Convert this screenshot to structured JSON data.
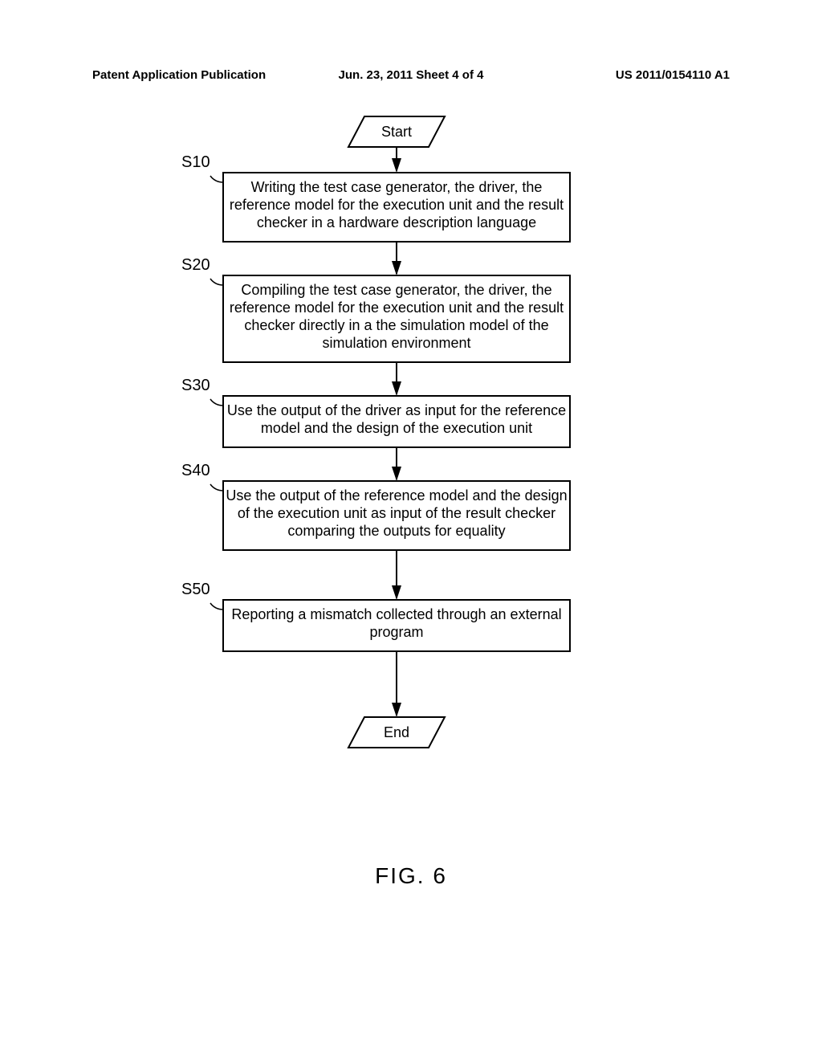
{
  "header": {
    "left": "Patent Application Publication",
    "center": "Jun. 23, 2011  Sheet 4 of 4",
    "right": "US 2011/0154110 A1"
  },
  "flow": {
    "start": "Start",
    "end": "End",
    "steps": [
      {
        "id": "S10",
        "text": [
          "Writing the test case generator, the driver, the",
          "reference model for the execution unit and the result",
          "checker in a hardware description language"
        ]
      },
      {
        "id": "S20",
        "text": [
          "Compiling the test case generator, the driver, the",
          "reference model for the execution unit and the result",
          "checker directly in a the simulation model of the",
          "simulation environment"
        ]
      },
      {
        "id": "S30",
        "text": [
          "Use the output of the driver as input for the reference",
          "model and the design of the execution unit"
        ]
      },
      {
        "id": "S40",
        "text": [
          "Use the output of the reference model and the design",
          "of the execution unit as input of the result checker",
          "comparing the outputs for equality"
        ]
      },
      {
        "id": "S50",
        "text": [
          "Reporting a mismatch collected through an external",
          "program"
        ]
      }
    ]
  },
  "figure": "FIG. 6"
}
